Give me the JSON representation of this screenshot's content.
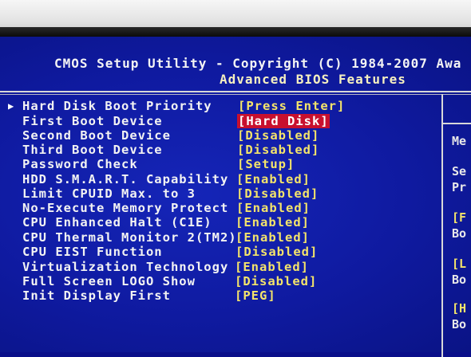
{
  "header": {
    "title": "CMOS Setup Utility - Copyright (C) 1984-2007 Awa",
    "subtitle": "Advanced BIOS Features"
  },
  "items": [
    {
      "label": "Hard Disk Boot Priority",
      "value": "[Press Enter]",
      "submenu": true
    },
    {
      "label": "First Boot Device",
      "value": "[Hard Disk]",
      "selected": true
    },
    {
      "label": "Second Boot Device",
      "value": "[Disabled]"
    },
    {
      "label": "Third Boot Device",
      "value": "[Disabled]"
    },
    {
      "label": "Password Check",
      "value": "[Setup]"
    },
    {
      "label": "HDD S.M.A.R.T. Capability",
      "value": "[Enabled]"
    },
    {
      "label": "Limit CPUID Max. to 3",
      "value": "[Disabled]"
    },
    {
      "label": "No-Execute Memory Protect",
      "value": "[Enabled]"
    },
    {
      "label": "CPU Enhanced Halt (C1E)",
      "value": "[Enabled]"
    },
    {
      "label": "CPU Thermal Monitor 2(TM2)",
      "value": "[Enabled]"
    },
    {
      "label": "CPU EIST Function",
      "value": "[Disabled]"
    },
    {
      "label": "Virtualization Technology",
      "value": "[Enabled]"
    },
    {
      "label": "Full Screen LOGO Show",
      "value": "[Disabled]"
    },
    {
      "label": "Init Display First",
      "value": "[PEG]"
    }
  ],
  "sidebar": {
    "lines": [
      "Me",
      "Se",
      "Pr",
      "[F",
      "Bo",
      "[L",
      "Bo",
      "[H",
      "Bo"
    ]
  },
  "colors": {
    "background": "#0f1aa0",
    "label": "#f3f3f3",
    "value": "#f4e46a",
    "highlight": "#c8102e"
  }
}
